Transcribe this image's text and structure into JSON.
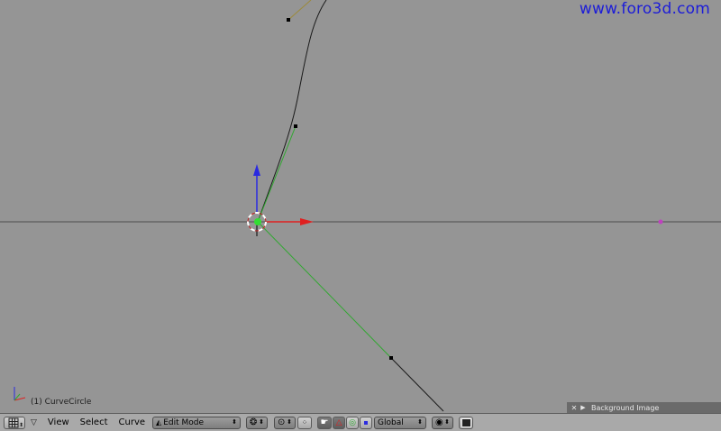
{
  "watermark": "www.foro3d.com",
  "viewport": {
    "object_label": "(1) CurveCircle",
    "background_panel": {
      "close": "✕",
      "expand": "▶",
      "label": "Background Image"
    }
  },
  "header": {
    "menus": {
      "view": "View",
      "select": "Select",
      "curve": "Curve"
    },
    "mode_value": "Edit Mode",
    "orientation_value": "Global"
  },
  "colors": {
    "viewport_bg": "#959595",
    "header_bg": "#a9a9a9",
    "x_axis": "#e02020",
    "z_axis": "#2a2ae0",
    "handle_line": "#2fa82f",
    "watermark": "#1c1cd8"
  }
}
